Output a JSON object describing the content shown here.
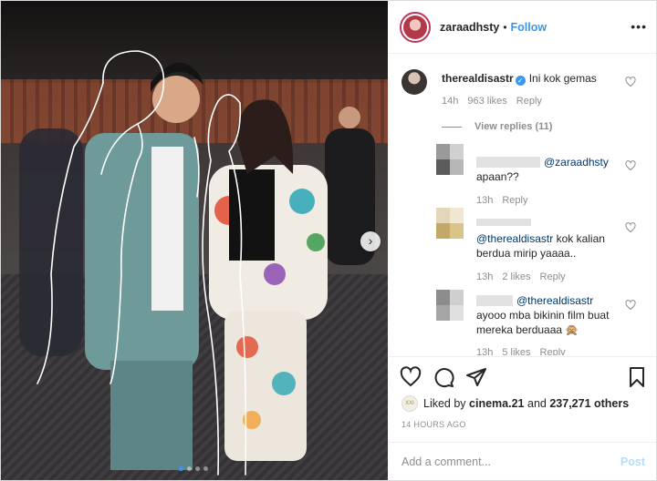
{
  "post": {
    "username": "zaraadhsty",
    "separator": "•",
    "follow_label": "Follow",
    "more_label": "•••",
    "carousel_next": "›",
    "carousel_dots": 4,
    "carousel_active": 0
  },
  "comments": [
    {
      "username": "therealdisastr",
      "verified": true,
      "text": "Ini kok gemas",
      "time": "14h",
      "likes": "963 likes",
      "reply": "Reply",
      "view_replies": "View replies (11)"
    },
    {
      "username": "",
      "mention": "@zaraadhsty",
      "text": "apaan??",
      "time": "13h",
      "reply": "Reply"
    },
    {
      "username": "",
      "mention": "@therealdisastr",
      "text": "kok kalian berdua mirip yaaaa..",
      "time": "13h",
      "likes": "2 likes",
      "reply": "Reply"
    },
    {
      "username": "",
      "mention": "@therealdisastr",
      "text": "ayooo mba bikinin film buat mereka berduaaa 🙊",
      "time": "13h",
      "likes": "5 likes",
      "reply": "Reply"
    }
  ],
  "likes": {
    "avatar_label": "XXI",
    "prefix": "Liked by",
    "user": "cinema.21",
    "and": "and",
    "count": "237,271 others"
  },
  "timestamp": "14 HOURS AGO",
  "comment_box": {
    "placeholder": "Add a comment...",
    "post_label": "Post"
  },
  "colors": {
    "accent": "#3897f0",
    "text": "#262626",
    "muted": "#8e8e8e",
    "post_disabled": "#b2dffc"
  }
}
